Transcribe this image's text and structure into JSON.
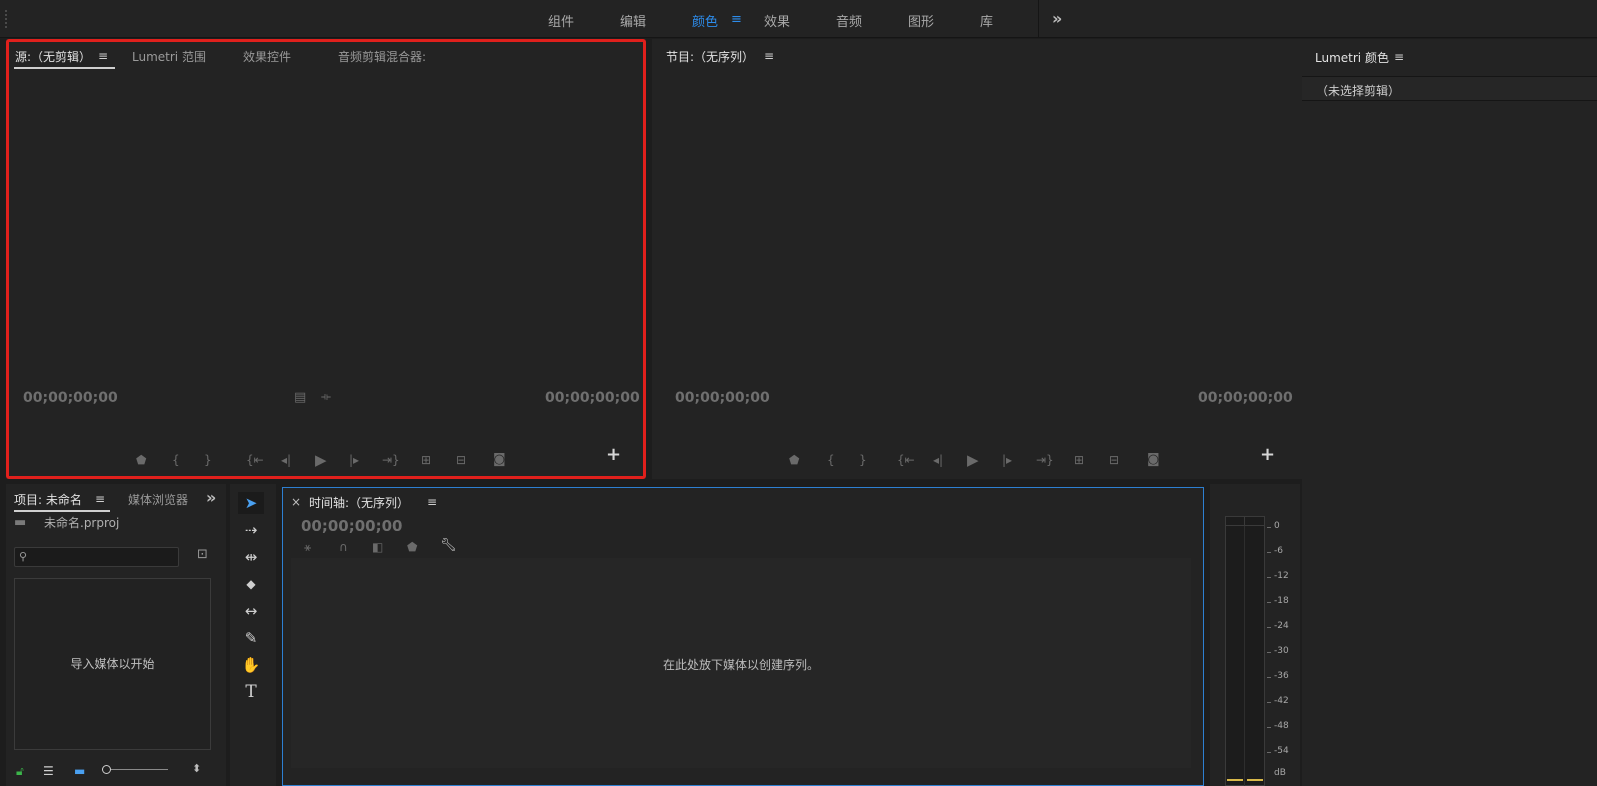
{
  "workspace_bar": {
    "tabs": [
      {
        "label": "组件",
        "active": false
      },
      {
        "label": "编辑",
        "active": false
      },
      {
        "label": "颜色",
        "active": true
      },
      {
        "label": "效果",
        "active": false
      },
      {
        "label": "音频",
        "active": false
      },
      {
        "label": "图形",
        "active": false
      },
      {
        "label": "库",
        "active": false
      }
    ],
    "menu_glyph": "≡",
    "more_glyph": "»"
  },
  "source_panel": {
    "tabs": [
      {
        "label": "源:（无剪辑）",
        "active": true
      },
      {
        "label": "Lumetri 范围",
        "active": false
      },
      {
        "label": "效果控件",
        "active": false
      },
      {
        "label": "音频剪辑混合器:",
        "active": false
      }
    ],
    "menu_glyph": "≡",
    "timecode_left": "00;00;00;00",
    "timecode_right": "00;00;00;00",
    "add_glyph": "+"
  },
  "program_panel": {
    "title": "节目:（无序列）",
    "menu_glyph": "≡",
    "timecode_left": "00;00;00;00",
    "timecode_right": "00;00;00;00",
    "add_glyph": "+"
  },
  "lumetri_panel": {
    "title": "Lumetri 颜色",
    "menu_glyph": "≡",
    "status": "（未选择剪辑）"
  },
  "project_panel": {
    "tabs": [
      {
        "label": "项目: 未命名",
        "active": true
      },
      {
        "label": "媒体浏览器",
        "active": false
      }
    ],
    "menu_glyph": "≡",
    "more_glyph": "»",
    "project_file": "未命名.prproj",
    "search_placeholder": "",
    "drop_hint": "导入媒体以开始"
  },
  "timeline_panel": {
    "close_glyph": "×",
    "title": "时间轴:（无序列）",
    "menu_glyph": "≡",
    "timecode": "00;00;00;00",
    "drop_hint": "在此处放下媒体以创建序列。"
  },
  "tools": [
    {
      "name": "selection-tool-icon",
      "glyph": "➤",
      "selected": true
    },
    {
      "name": "track-select-tool-icon",
      "glyph": "⇢",
      "selected": false
    },
    {
      "name": "ripple-edit-tool-icon",
      "glyph": "⇹",
      "selected": false
    },
    {
      "name": "razor-tool-icon",
      "glyph": "◆",
      "selected": false
    },
    {
      "name": "slip-tool-icon",
      "glyph": "↔",
      "selected": false
    },
    {
      "name": "pen-tool-icon",
      "glyph": "✎",
      "selected": false
    },
    {
      "name": "hand-tool-icon",
      "glyph": "✋",
      "selected": false
    },
    {
      "name": "type-tool-icon",
      "glyph": "T",
      "selected": false
    }
  ],
  "audio_meter": {
    "scale": [
      "0",
      "-6",
      "-12",
      "-18",
      "-24",
      "-30",
      "-36",
      "-42",
      "-48",
      "-54",
      "dB"
    ]
  },
  "colors": {
    "accent": "#2d8ceb",
    "highlight_border": "#e0201c",
    "background": "#232323"
  }
}
